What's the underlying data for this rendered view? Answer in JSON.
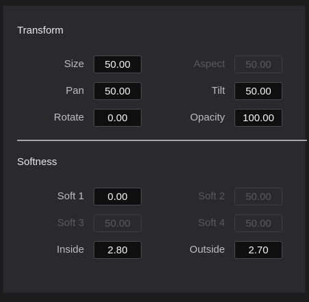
{
  "transform": {
    "title": "Transform",
    "size": {
      "label": "Size",
      "value": "50.00"
    },
    "aspect": {
      "label": "Aspect",
      "value": "50.00"
    },
    "pan": {
      "label": "Pan",
      "value": "50.00"
    },
    "tilt": {
      "label": "Tilt",
      "value": "50.00"
    },
    "rotate": {
      "label": "Rotate",
      "value": "0.00"
    },
    "opacity": {
      "label": "Opacity",
      "value": "100.00"
    }
  },
  "softness": {
    "title": "Softness",
    "soft1": {
      "label": "Soft 1",
      "value": "0.00"
    },
    "soft2": {
      "label": "Soft 2",
      "value": "50.00"
    },
    "soft3": {
      "label": "Soft 3",
      "value": "50.00"
    },
    "soft4": {
      "label": "Soft 4",
      "value": "50.00"
    },
    "inside": {
      "label": "Inside",
      "value": "2.80"
    },
    "outside": {
      "label": "Outside",
      "value": "2.70"
    }
  }
}
